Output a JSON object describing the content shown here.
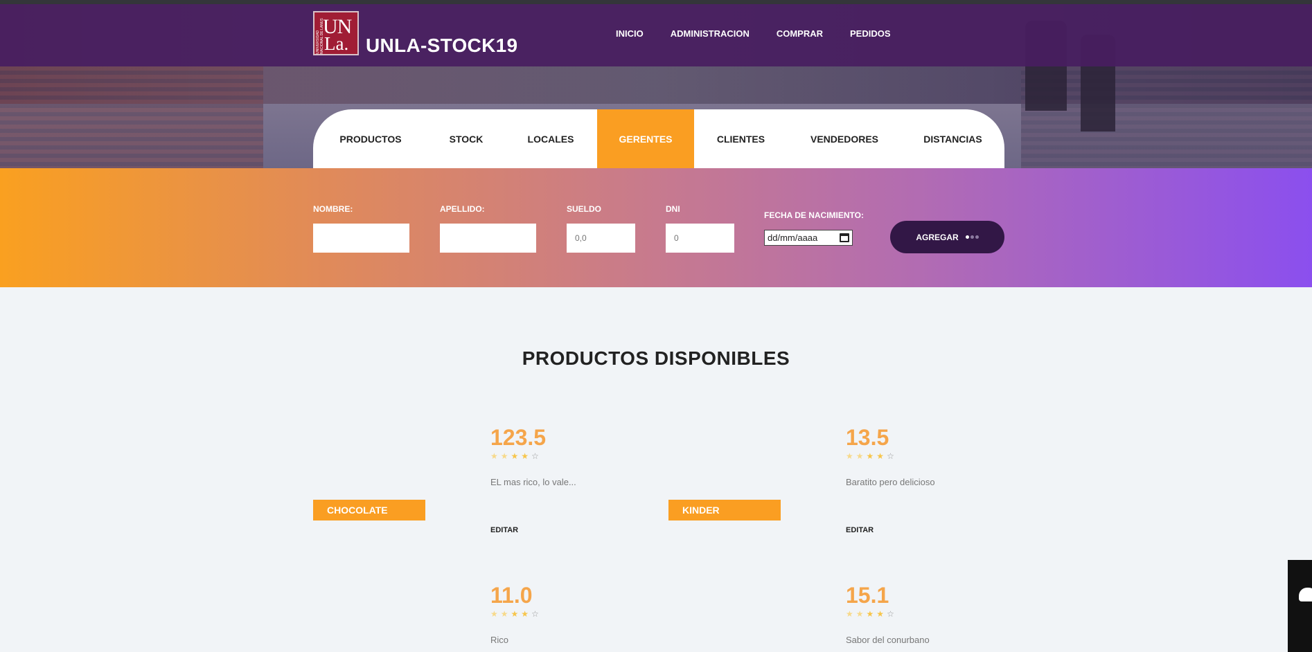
{
  "brand": {
    "logo_un": "UN",
    "logo_la": "La.",
    "logo_small": "UNIVERSIDAD NACIONAL DE LANUS",
    "title": "UNLA-STOCK19"
  },
  "mainnav": [
    "INICIO",
    "ADMINISTRACION",
    "COMPRAR",
    "PEDIDOS"
  ],
  "tabs": {
    "items": [
      "PRODUCTOS",
      "STOCK",
      "LOCALES",
      "GERENTES",
      "CLIENTES",
      "VENDEDORES",
      "DISTANCIAS"
    ],
    "active": "GERENTES"
  },
  "form": {
    "nombre_label": "NOMBRE:",
    "apellido_label": "APELLIDO:",
    "sueldo_label": "SUELDO",
    "sueldo_placeholder": "0,0",
    "dni_label": "DNI",
    "dni_placeholder": "0",
    "fecha_label": "FECHA DE NACIMIENTO:",
    "fecha_placeholder": "dd/mm/aaaa",
    "submit_label": "AGREGAR"
  },
  "products_section": {
    "title": "PRODUCTOS DISPONIBLES",
    "items": [
      {
        "name": "CHOCOLATE",
        "price": "123.5",
        "rating": 4,
        "description": "EL mas rico, lo vale...",
        "edit_label": "EDITAR"
      },
      {
        "name": "KINDER",
        "price": "13.5",
        "rating": 4,
        "description": "Baratito pero delicioso",
        "edit_label": "EDITAR"
      },
      {
        "name": "",
        "price": "11.0",
        "rating": 4,
        "description": "Rico",
        "edit_label": ""
      },
      {
        "name": "",
        "price": "15.1",
        "rating": 4,
        "description": "Sabor del conurbano",
        "edit_label": ""
      }
    ]
  },
  "colors": {
    "accent_orange": "#fa9e22",
    "nav_purple": "#481e60",
    "button_dark": "#321746",
    "price_orange": "#f5a54a"
  }
}
